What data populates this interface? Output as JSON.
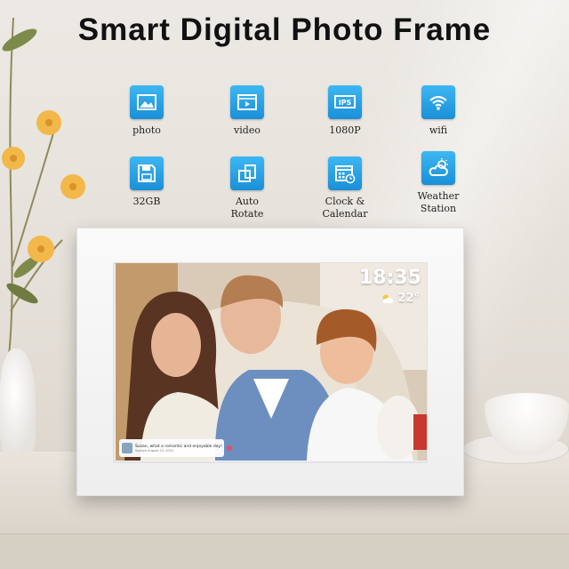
{
  "header": {
    "title": "Smart Digital Photo Frame"
  },
  "features": [
    {
      "label": "photo",
      "icon": "photo-icon"
    },
    {
      "label": "video",
      "icon": "video-icon"
    },
    {
      "label": "1080P",
      "icon": "ips-icon",
      "badge": "IPS"
    },
    {
      "label": "wifi",
      "icon": "wifi-icon"
    },
    {
      "label": "32GB",
      "icon": "storage-icon"
    },
    {
      "label": "Auto\nRotate",
      "icon": "rotate-icon"
    },
    {
      "label": "Clock &\nCalendar",
      "icon": "calendar-icon"
    },
    {
      "label": "Weather\nStation",
      "icon": "weather-icon"
    }
  ],
  "screen": {
    "time": "18:35",
    "temperature": "22°",
    "message": {
      "text": "Susan, what a romantic and enjoyable day!",
      "meta": "Sophye August 23, 2022"
    }
  },
  "colors": {
    "icon_bg": "#1a8fd8",
    "frame": "#f5f5f5",
    "heart": "#e34c6b"
  }
}
